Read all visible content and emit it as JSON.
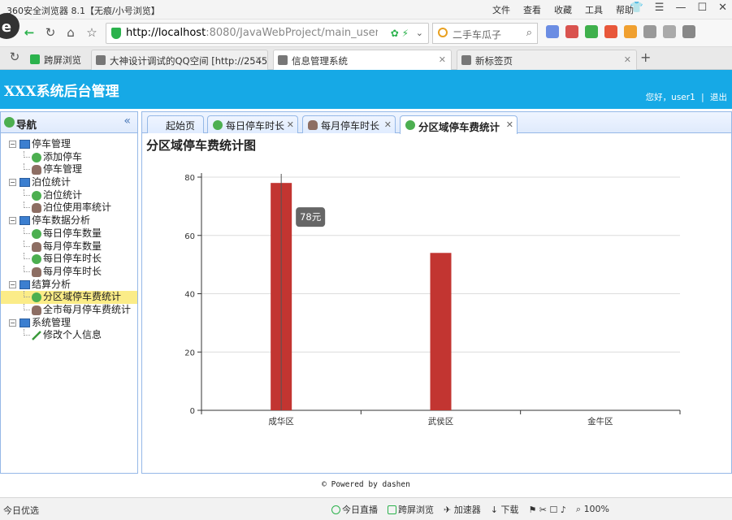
{
  "browser": {
    "title": "360安全浏览器 8.1【无痕/小号浏览】",
    "menus": [
      "文件",
      "查看",
      "收藏",
      "工具",
      "帮助"
    ],
    "url_host": "http://localhost",
    "url_rest": ":8080/JavaWebProject/main_user.",
    "search_text": "二手车瓜子",
    "tabs": [
      {
        "label": "跨屏浏览"
      },
      {
        "label": "大神设计调试的QQ空间 [http://2545"
      },
      {
        "label": "信息管理系统"
      },
      {
        "label": "新标签页"
      }
    ]
  },
  "app": {
    "title": "XXX系统后台管理",
    "greeting": "您好，user1",
    "logout": "退出"
  },
  "sidebar": {
    "title": "导航",
    "groups": [
      {
        "label": "停车管理",
        "items": [
          "添加停车",
          "停车管理"
        ]
      },
      {
        "label": "泊位统计",
        "items": [
          "泊位统计",
          "泊位使用率统计"
        ]
      },
      {
        "label": "停车数据分析",
        "items": [
          "每日停车数量",
          "每月停车数量",
          "每日停车时长",
          "每月停车时长"
        ]
      },
      {
        "label": "结算分析",
        "items": [
          "分区域停车费统计",
          "全市每月停车费统计"
        ]
      },
      {
        "label": "系统管理",
        "items": [
          "修改个人信息"
        ]
      }
    ]
  },
  "content_tabs": [
    {
      "label": "起始页"
    },
    {
      "label": "每日停车时长"
    },
    {
      "label": "每月停车时长"
    },
    {
      "label": "分区域停车费统计"
    }
  ],
  "chart_title": "分区域停车费统计图",
  "chart_data": {
    "type": "bar",
    "categories": [
      "成华区",
      "武侯区",
      "金牛区"
    ],
    "values": [
      78,
      54,
      0
    ],
    "ylim": [
      0,
      80
    ],
    "yticks": [
      0,
      20,
      40,
      60,
      80
    ],
    "grid": true,
    "color": "#c23531",
    "tooltip": "78元"
  },
  "footer": "© Powered by dashen",
  "statusbar": {
    "left": "今日优选",
    "items": [
      "今日直播",
      "跨屏浏览",
      "加速器",
      "下载",
      "100%"
    ]
  }
}
